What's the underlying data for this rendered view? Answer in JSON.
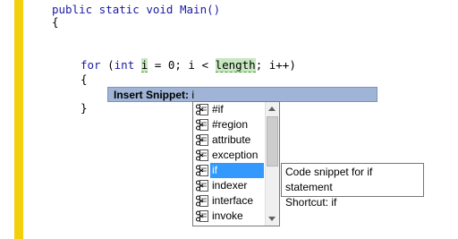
{
  "editor": {
    "line1_a": "public static void Main()",
    "line2": "{",
    "for_kw": "for",
    "for_open": " (",
    "int_kw": "int",
    "var_i": "i",
    "for_mid": " = 0; i < ",
    "length": "length",
    "for_end": "; i++)",
    "brace_open": "{",
    "brace_close": "}"
  },
  "insert_snippet": {
    "label": "Insert Snippet:",
    "value": "i"
  },
  "snippet_list": {
    "items": [
      {
        "label": "#if",
        "icon": "snippet-icon"
      },
      {
        "label": "#region",
        "icon": "snippet-icon"
      },
      {
        "label": "attribute",
        "icon": "snippet-icon"
      },
      {
        "label": "exception",
        "icon": "snippet-icon"
      },
      {
        "label": "if",
        "icon": "snippet-icon",
        "selected": true
      },
      {
        "label": "indexer",
        "icon": "snippet-icon"
      },
      {
        "label": "interface",
        "icon": "snippet-icon"
      },
      {
        "label": "invoke",
        "icon": "snippet-icon"
      }
    ]
  },
  "tooltip": {
    "line1": "Code snippet for if statement",
    "line2": "Shortcut: if"
  },
  "colors": {
    "keyword": "#1a1aa6",
    "gutter": "#f2d10a",
    "selection": "#3399ff",
    "insert_bar": "#9fb4d6"
  }
}
